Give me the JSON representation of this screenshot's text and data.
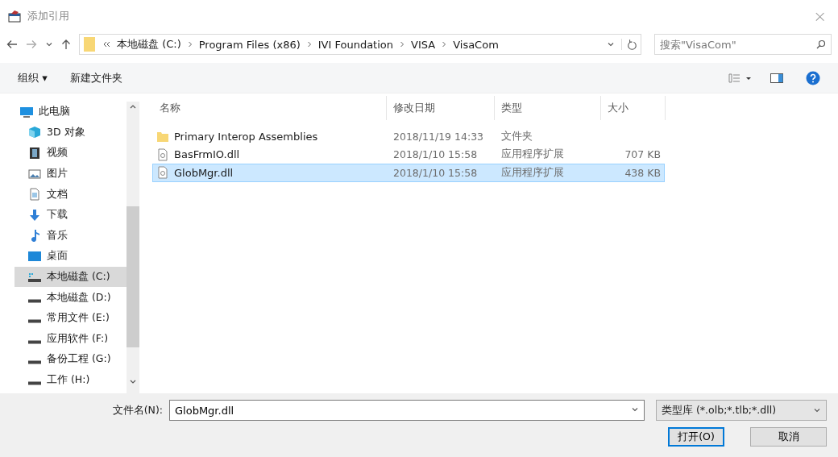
{
  "window": {
    "title": "添加引用",
    "close": "×"
  },
  "nav": {
    "path": [
      {
        "label": "本地磁盘 (C:)"
      },
      {
        "label": "Program Files (x86)"
      },
      {
        "label": "IVI Foundation"
      },
      {
        "label": "VISA"
      },
      {
        "label": "VisaCom"
      }
    ],
    "search": {
      "placeholder": "搜索\"VisaCom\""
    }
  },
  "toolbar": {
    "organize": "组织 ▾",
    "new_folder": "新建文件夹"
  },
  "sidebar": {
    "items": [
      {
        "label": "此电脑",
        "kind": "pc",
        "selected": false,
        "children": [
          {
            "label": "3D 对象",
            "kind": "cube",
            "selected": false
          },
          {
            "label": "视频",
            "kind": "video",
            "selected": false
          },
          {
            "label": "图片",
            "kind": "image",
            "selected": false
          },
          {
            "label": "文档",
            "kind": "document",
            "selected": false
          },
          {
            "label": "下载",
            "kind": "download",
            "selected": false
          },
          {
            "label": "音乐",
            "kind": "music",
            "selected": false
          },
          {
            "label": "桌面",
            "kind": "desktop",
            "selected": false
          },
          {
            "label": "本地磁盘 (C:)",
            "kind": "system-drive",
            "selected": true
          },
          {
            "label": "本地磁盘 (D:)",
            "kind": "drive",
            "selected": false
          },
          {
            "label": "常用文件 (E:)",
            "kind": "drive",
            "selected": false
          },
          {
            "label": "应用软件 (F:)",
            "kind": "drive",
            "selected": false
          },
          {
            "label": "备份工程 (G:)",
            "kind": "drive",
            "selected": false
          },
          {
            "label": "工作 (H:)",
            "kind": "drive",
            "selected": false
          }
        ]
      }
    ]
  },
  "table": {
    "columns": [
      "名称",
      "修改日期",
      "类型",
      "大小"
    ],
    "rows": [
      {
        "kind": "folder",
        "name": "Primary Interop Assemblies",
        "date": "2018/11/19 14:33",
        "type": "文件夹",
        "selected": false
      },
      {
        "kind": "dll",
        "name": "BasFrmIO.dll",
        "date": "2018/1/10 15:58",
        "type": "应用程序扩展",
        "size": "707 KB",
        "selected": false
      },
      {
        "kind": "dll",
        "name": "GlobMgr.dll",
        "date": "2018/1/10 15:58",
        "type": "应用程序扩展",
        "size": "438 KB",
        "selected": true
      }
    ]
  },
  "footer": {
    "filename_label": "文件名(N):",
    "filename": "GlobMgr.dll",
    "filter": "类型库 (*.olb;*.tlb;*.dll)",
    "buttons": [
      {
        "label": "打开(O)",
        "primary": true
      },
      {
        "label": "取消",
        "primary": false
      }
    ]
  }
}
